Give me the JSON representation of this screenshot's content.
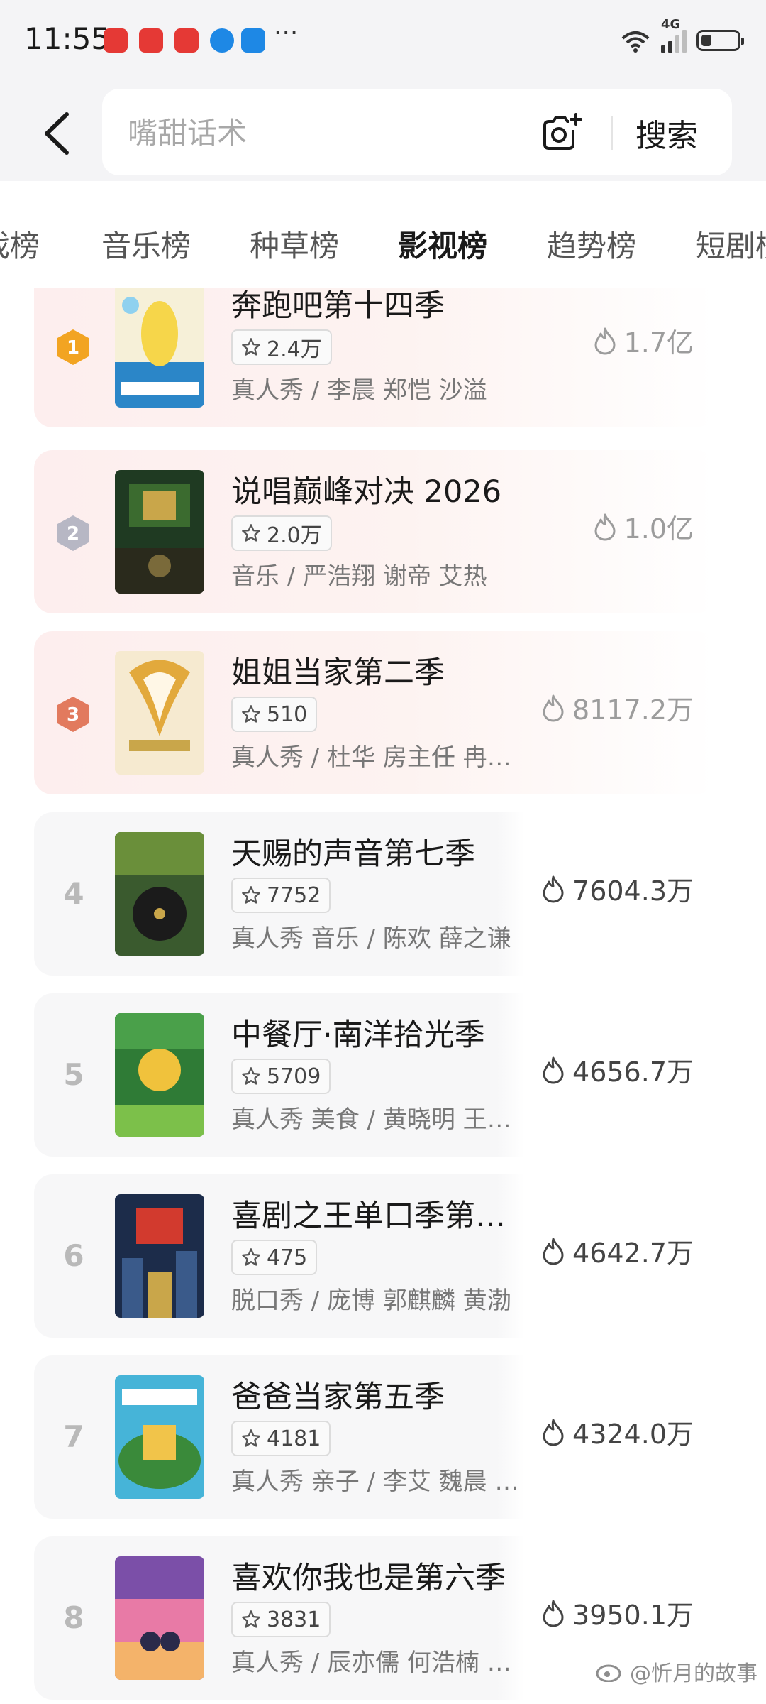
{
  "status_bar": {
    "time": "11:55",
    "network": "4G"
  },
  "search": {
    "placeholder": "嘴甜话术",
    "button_label": "搜索"
  },
  "tabs": [
    {
      "label": "戏榜",
      "active": false
    },
    {
      "label": "音乐榜",
      "active": false
    },
    {
      "label": "种草榜",
      "active": false
    },
    {
      "label": "影视榜",
      "active": true
    },
    {
      "label": "趋势榜",
      "active": false
    },
    {
      "label": "短剧榜",
      "active": false
    }
  ],
  "rankings": [
    {
      "rank": "1",
      "title": "奔跑吧第十四季",
      "rating": "2.4万",
      "meta": "真人秀 / 李晨 郑恺 沙溢",
      "heat": "1.7亿",
      "poster_colors": [
        "#f6d64a",
        "#2b86c8",
        "#ffffff"
      ]
    },
    {
      "rank": "2",
      "title": "说唱巅峰对决 2026",
      "rating": "2.0万",
      "meta": "音乐 / 严浩翔 谢帝 艾热",
      "heat": "1.0亿",
      "poster_colors": [
        "#1f4a2a",
        "#3b6b2f",
        "#c9a64a"
      ]
    },
    {
      "rank": "3",
      "title": "姐姐当家第二季",
      "rating": "510",
      "meta": "真人秀 / 杜华 房主任 冉莹颖",
      "heat": "8117.2万",
      "poster_colors": [
        "#f3e2b6",
        "#e2a93c",
        "#fff7e6"
      ]
    },
    {
      "rank": "4",
      "title": "天赐的声音第七季",
      "rating": "7752",
      "meta": "真人秀 音乐 / 陈欢 薛之谦",
      "heat": "7604.3万",
      "poster_colors": [
        "#2d4d2c",
        "#6a8f3a",
        "#1b1b1b"
      ]
    },
    {
      "rank": "5",
      "title": "中餐厅·南洋拾光季",
      "rating": "5709",
      "meta": "真人秀 美食 / 黄晓明 王一博",
      "heat": "4656.7万",
      "poster_colors": [
        "#2f7b36",
        "#7cc04a",
        "#f0c23c"
      ]
    },
    {
      "rank": "6",
      "title": "喜剧之王单口季第二季",
      "rating": "475",
      "meta": "脱口秀 / 庞博 郭麒麟 黄渤",
      "heat": "4642.7万",
      "poster_colors": [
        "#1c2c4a",
        "#d23a2e",
        "#3a5a8a"
      ]
    },
    {
      "rank": "7",
      "title": "爸爸当家第五季",
      "rating": "4181",
      "meta": "真人秀 亲子 / 李艾 魏晨 杨子",
      "heat": "4324.0万",
      "poster_colors": [
        "#46b4d8",
        "#f1c44a",
        "#3a8a3a"
      ]
    },
    {
      "rank": "8",
      "title": "喜欢你我也是第六季",
      "rating": "3831",
      "meta": "真人秀 / 辰亦儒 何浩楠 周扬",
      "heat": "3950.1万",
      "poster_colors": [
        "#7b4fa8",
        "#e87aa6",
        "#f4b36a"
      ]
    }
  ],
  "colors": {
    "gold": "#f2a422",
    "silver": "#b7b7c4",
    "bronze": "#e27a5e"
  },
  "watermark": "@忻月的故事"
}
